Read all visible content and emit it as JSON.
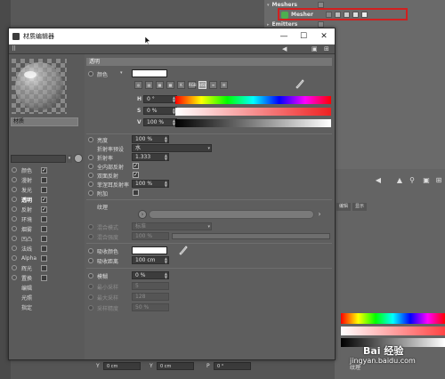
{
  "background": {
    "objects": [
      {
        "name": "Meshers",
        "selected": false
      },
      {
        "name": "Mesher",
        "selected": true
      },
      {
        "name": "Emitters",
        "selected": false
      }
    ],
    "right_tabs": [
      "编辑",
      "显示"
    ],
    "texture_label": "纹理",
    "bottom_fields": [
      {
        "label": "Y",
        "value": "0 cm"
      },
      {
        "label": "Y",
        "value": "0 cm"
      },
      {
        "label": "P",
        "value": "0 °"
      }
    ],
    "highlight_color": "#d02020"
  },
  "dialog": {
    "title": "材质编辑器",
    "material_name": "材质",
    "channels": [
      {
        "label": "颜色",
        "checked": true
      },
      {
        "label": "漫射",
        "checked": false
      },
      {
        "label": "发光",
        "checked": false
      },
      {
        "label": "透明",
        "checked": true,
        "selected": true
      },
      {
        "label": "反射",
        "checked": true
      },
      {
        "label": "环境",
        "checked": false
      },
      {
        "label": "烟雾",
        "checked": false
      },
      {
        "label": "凹凸",
        "checked": false
      },
      {
        "label": "法线",
        "checked": false
      },
      {
        "label": "Alpha",
        "checked": false
      },
      {
        "label": "辉光",
        "checked": false
      },
      {
        "label": "置换",
        "checked": false
      }
    ],
    "extra_items": [
      "编辑",
      "光照",
      "指定"
    ],
    "section_title": "透明",
    "color_label": "颜色",
    "color_value": "#ffffff",
    "hsv": {
      "h_label": "H",
      "h_value": "0 °",
      "s_label": "S",
      "s_value": "0 %",
      "v_label": "V",
      "v_value": "100 %"
    },
    "mode_buttons": [
      "RGB",
      "HSV"
    ],
    "params": {
      "brightness_label": "亮度",
      "brightness_value": "100 %",
      "refraction_preset_label": "折射率预设",
      "refraction_preset_value": "水",
      "refraction_label": "折射率",
      "refraction_value": "1.333",
      "total_reflection_label": "全内部反射",
      "double_reflection_label": "双面反射",
      "fresnel_label": "菲涅耳反射率",
      "fresnel_value": "100 %",
      "additive_label": "附加",
      "texture_label": "纹理",
      "blend_mode_label": "混合模式",
      "blend_mode_value": "标准",
      "blend_strength_label": "混合强度",
      "blend_strength_value": "100 %",
      "absorb_color_label": "吸收颜色",
      "absorb_distance_label": "吸收距离",
      "absorb_distance_value": "100 cm",
      "blur_label": "模糊",
      "blur_value": "0 %",
      "min_samples_label": "最小采样",
      "min_samples_value": "5",
      "max_samples_label": "最大采样",
      "max_samples_value": "128",
      "accuracy_label": "采样精度",
      "accuracy_value": "50 %"
    }
  },
  "watermark": {
    "site": "jingyan.baidu.com",
    "brand": "Bai 经验"
  }
}
